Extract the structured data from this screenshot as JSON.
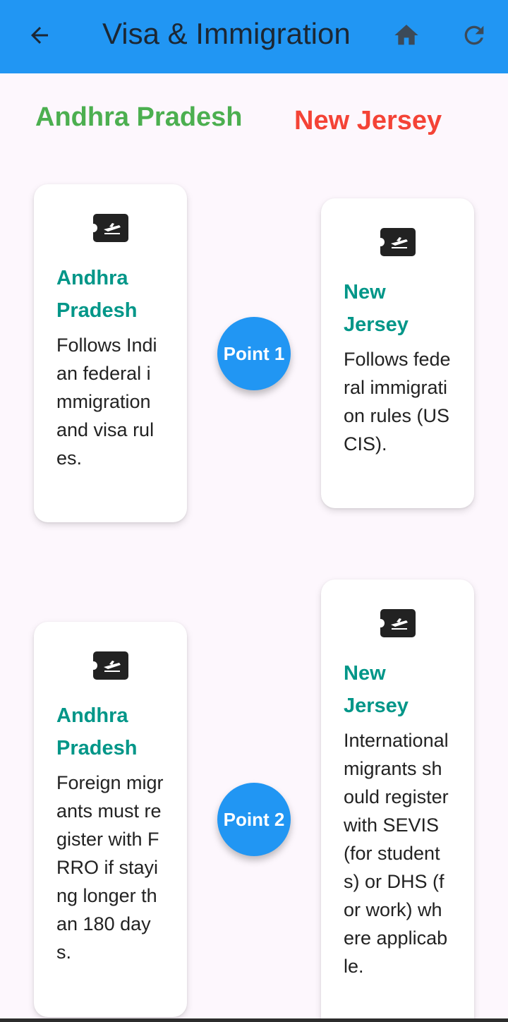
{
  "appbar": {
    "title": "Visa & Immigration",
    "back_icon": "arrow-back-icon",
    "home_icon": "home-icon",
    "refresh_icon": "refresh-icon",
    "bg_color": "#2196f3"
  },
  "headings": {
    "left": "Andhra Pradesh",
    "left_color": "#4caf50",
    "right": "New Jersey",
    "right_color": "#f44336"
  },
  "points": [
    {
      "label": "Point 1",
      "left_card": {
        "icon": "airplane-ticket-icon",
        "title": "Andhra Pradesh",
        "text": "Follows Indian federal immigration and visa rules."
      },
      "right_card": {
        "icon": "airplane-ticket-icon",
        "title": "New Jersey",
        "text": "Follows federal immigration rules (USCIS)."
      }
    },
    {
      "label": "Point 2",
      "left_card": {
        "icon": "airplane-ticket-icon",
        "title": "Andhra Pradesh",
        "text": "Foreign migrants must register with FRRO if staying longer than 180 days."
      },
      "right_card": {
        "icon": "airplane-ticket-icon",
        "title": "New Jersey",
        "text": "International migrants should register with SEVIS (for students) or DHS (for work) where applicable."
      }
    }
  ]
}
